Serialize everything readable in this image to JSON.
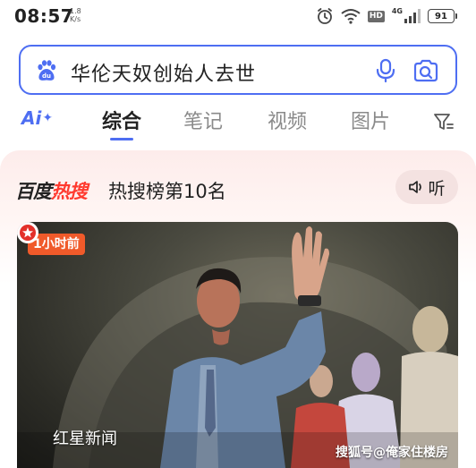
{
  "status_bar": {
    "time": "08:57",
    "net_speed_value": "1.8",
    "net_speed_unit": "K/s",
    "hd_label": "HD",
    "network_type": "4G",
    "battery": "91",
    "icons": [
      "alarm-icon",
      "wifi-icon",
      "signal-icon",
      "battery-icon"
    ]
  },
  "search": {
    "query": "华伦天奴创始人去世",
    "icons": [
      "baidu-paw-icon",
      "mic-icon",
      "camera-search-icon"
    ],
    "accent_color": "#4e6ef2"
  },
  "tabs": {
    "ai_label": "Ai",
    "items": [
      {
        "label": "综合",
        "active": true
      },
      {
        "label": "笔记",
        "active": false
      },
      {
        "label": "视频",
        "active": false
      },
      {
        "label": "图片",
        "active": false
      }
    ]
  },
  "hot_card": {
    "brand_prefix": "百度",
    "brand_hot": "热搜",
    "rank_text": "热搜榜第10名",
    "listen_label": "听"
  },
  "news": {
    "time_badge": "1小时前",
    "source_name": "红星新闻",
    "watermark": "搜狐号@俺家住楼房"
  },
  "colors": {
    "hot_red": "#ff3a2f",
    "badge_orange": "#f05a2a"
  }
}
